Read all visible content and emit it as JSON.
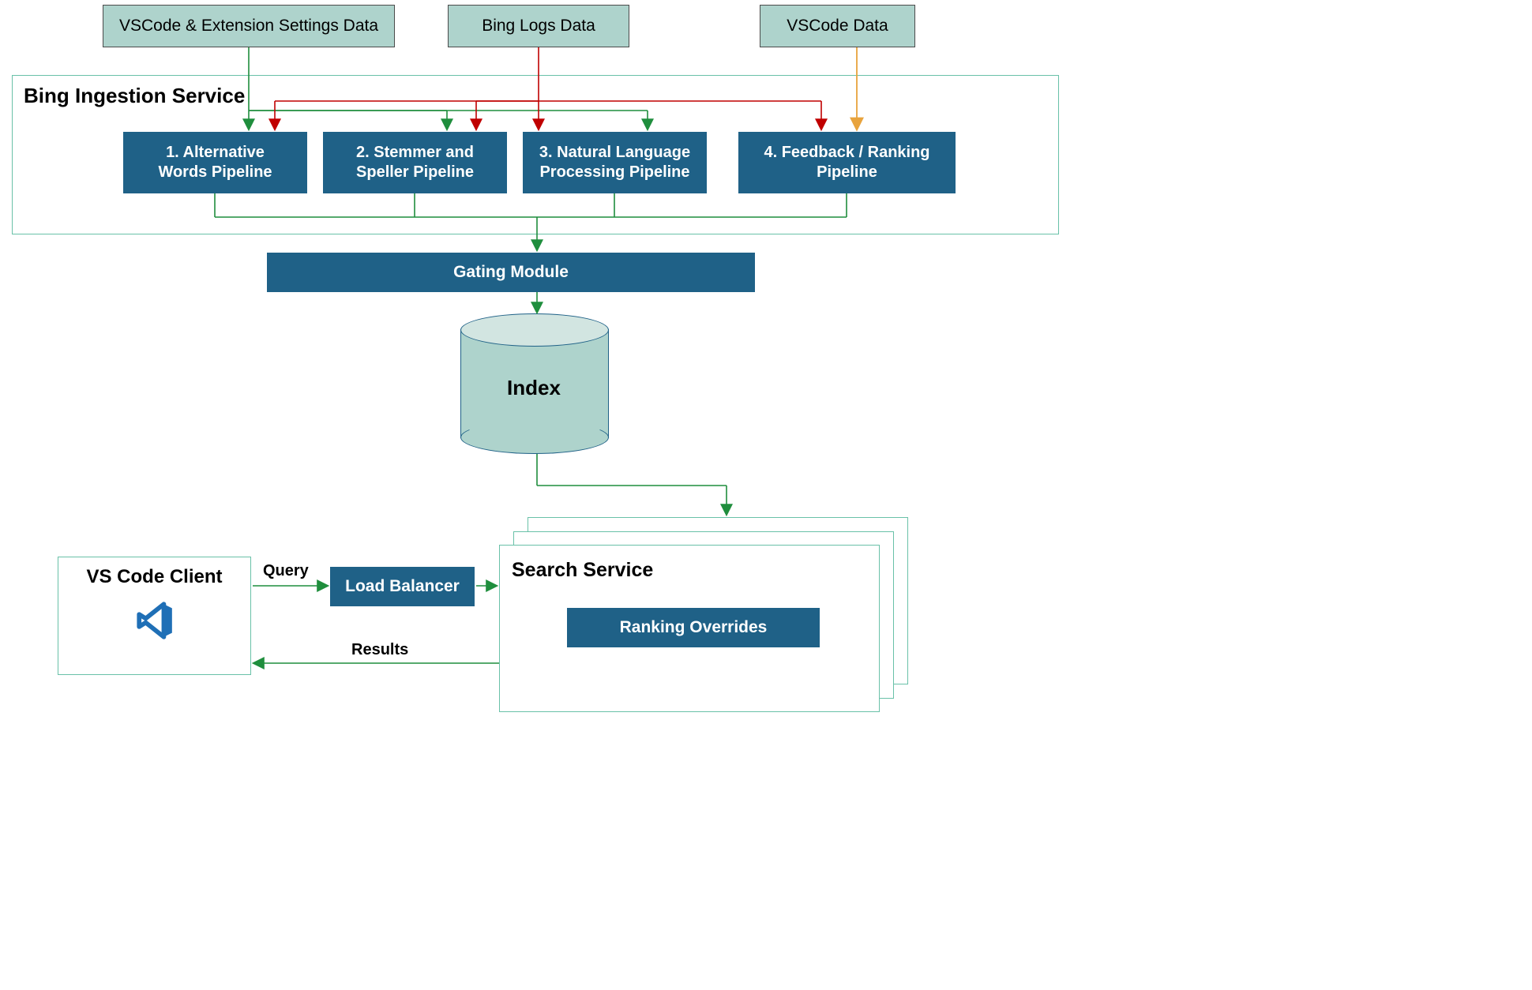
{
  "data_sources": {
    "s1": "VSCode & Extension Settings Data",
    "s2": "Bing Logs Data",
    "s3": "VSCode Data"
  },
  "ingestion": {
    "title": "Bing Ingestion Service",
    "pipelines": {
      "p1_l1": "1. Alternative",
      "p1_l2": "Words Pipeline",
      "p2_l1": "2. Stemmer and",
      "p2_l2": "Speller Pipeline",
      "p3_l1": "3. Natural Language",
      "p3_l2": "Processing Pipeline",
      "p4_l1": "4. Feedback / Ranking",
      "p4_l2": "Pipeline"
    }
  },
  "gating": "Gating Module",
  "index_label": "Index",
  "client": {
    "title": "VS Code Client",
    "icon_name": "vscode-icon"
  },
  "balancer": "Load Balancer",
  "search_service": {
    "title": "Search Service",
    "ranking": "Ranking Overrides"
  },
  "edges": {
    "query": "Query",
    "results": "Results"
  },
  "colors": {
    "green": "#1F8E3D",
    "red": "#C00000",
    "orange": "#E8A33D",
    "teal": "#69c1a8"
  }
}
